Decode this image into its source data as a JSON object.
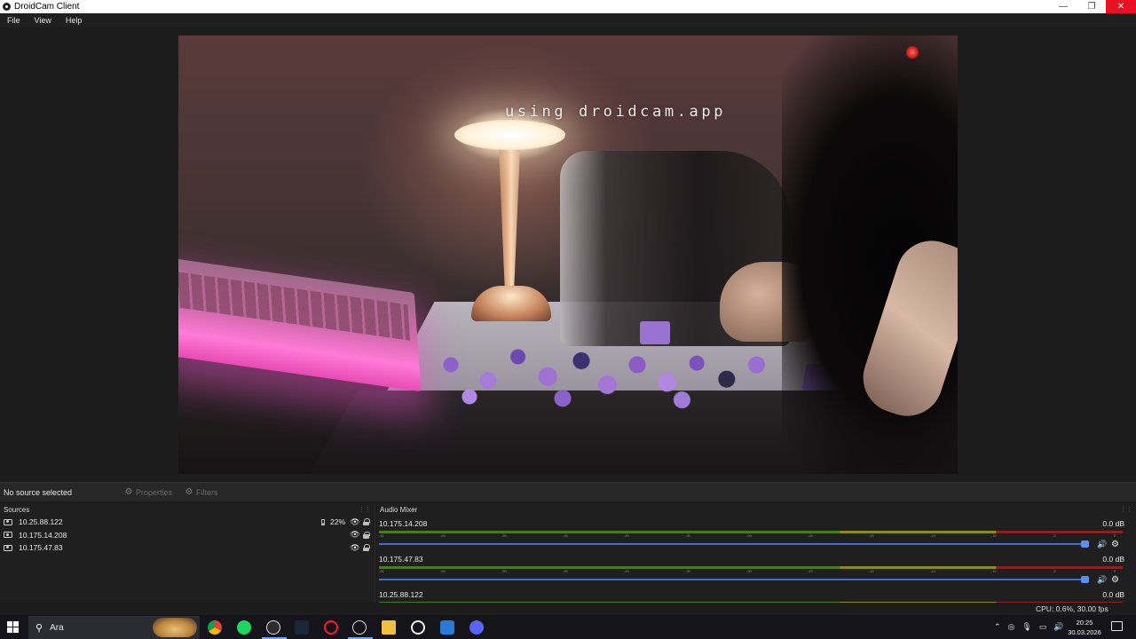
{
  "window": {
    "title": "DroidCam Client",
    "minimize_glyph": "—",
    "restore_glyph": "❐",
    "close_glyph": "✕"
  },
  "menu": [
    "File",
    "View",
    "Help"
  ],
  "preview": {
    "watermark": "using droidcam.app"
  },
  "properties_bar": {
    "status": "No source selected",
    "properties_label": "Properties",
    "filters_label": "Filters"
  },
  "sources": {
    "header": "Sources",
    "items": [
      {
        "name": "10.25.88.122",
        "battery": "22%",
        "icon": "camera-icon"
      },
      {
        "name": "10.175.14.208",
        "battery": "",
        "icon": "camera-icon"
      },
      {
        "name": "10.175.47.83",
        "battery": "",
        "icon": "camera-icon"
      }
    ]
  },
  "mixer": {
    "header": "Audio Mixer",
    "tick_labels": [
      "-60",
      "-55",
      "-50",
      "-45",
      "-40",
      "-35",
      "-30",
      "-25",
      "-20",
      "-15",
      "-10",
      "-5",
      "0"
    ],
    "channels": [
      {
        "name": "10.175.14.208",
        "level": "0.0 dB",
        "volume_fraction": 1.0
      },
      {
        "name": "10.175.47.83",
        "level": "0.0 dB",
        "volume_fraction": 1.0
      },
      {
        "name": "10.25.88.122",
        "level": "0.0 dB",
        "volume_fraction": 1.0
      }
    ],
    "colors": {
      "meter_green": "#4c7a1e",
      "meter_yellow": "#8a8a1e",
      "meter_red": "#8a2020",
      "fader": "#3d6ed0"
    }
  },
  "status": {
    "cpu": "CPU: 0.6%, 30.00 fps"
  },
  "taskbar": {
    "search_placeholder": "Ara",
    "apps": [
      "chrome-icon",
      "spotify-icon",
      "obs-icon",
      "steam-icon",
      "opera-icon",
      "github-icon",
      "file-explorer-icon",
      "settings-icon",
      "vscode-icon",
      "discord-icon"
    ],
    "time": "20:25",
    "date": "30.03.2026"
  }
}
